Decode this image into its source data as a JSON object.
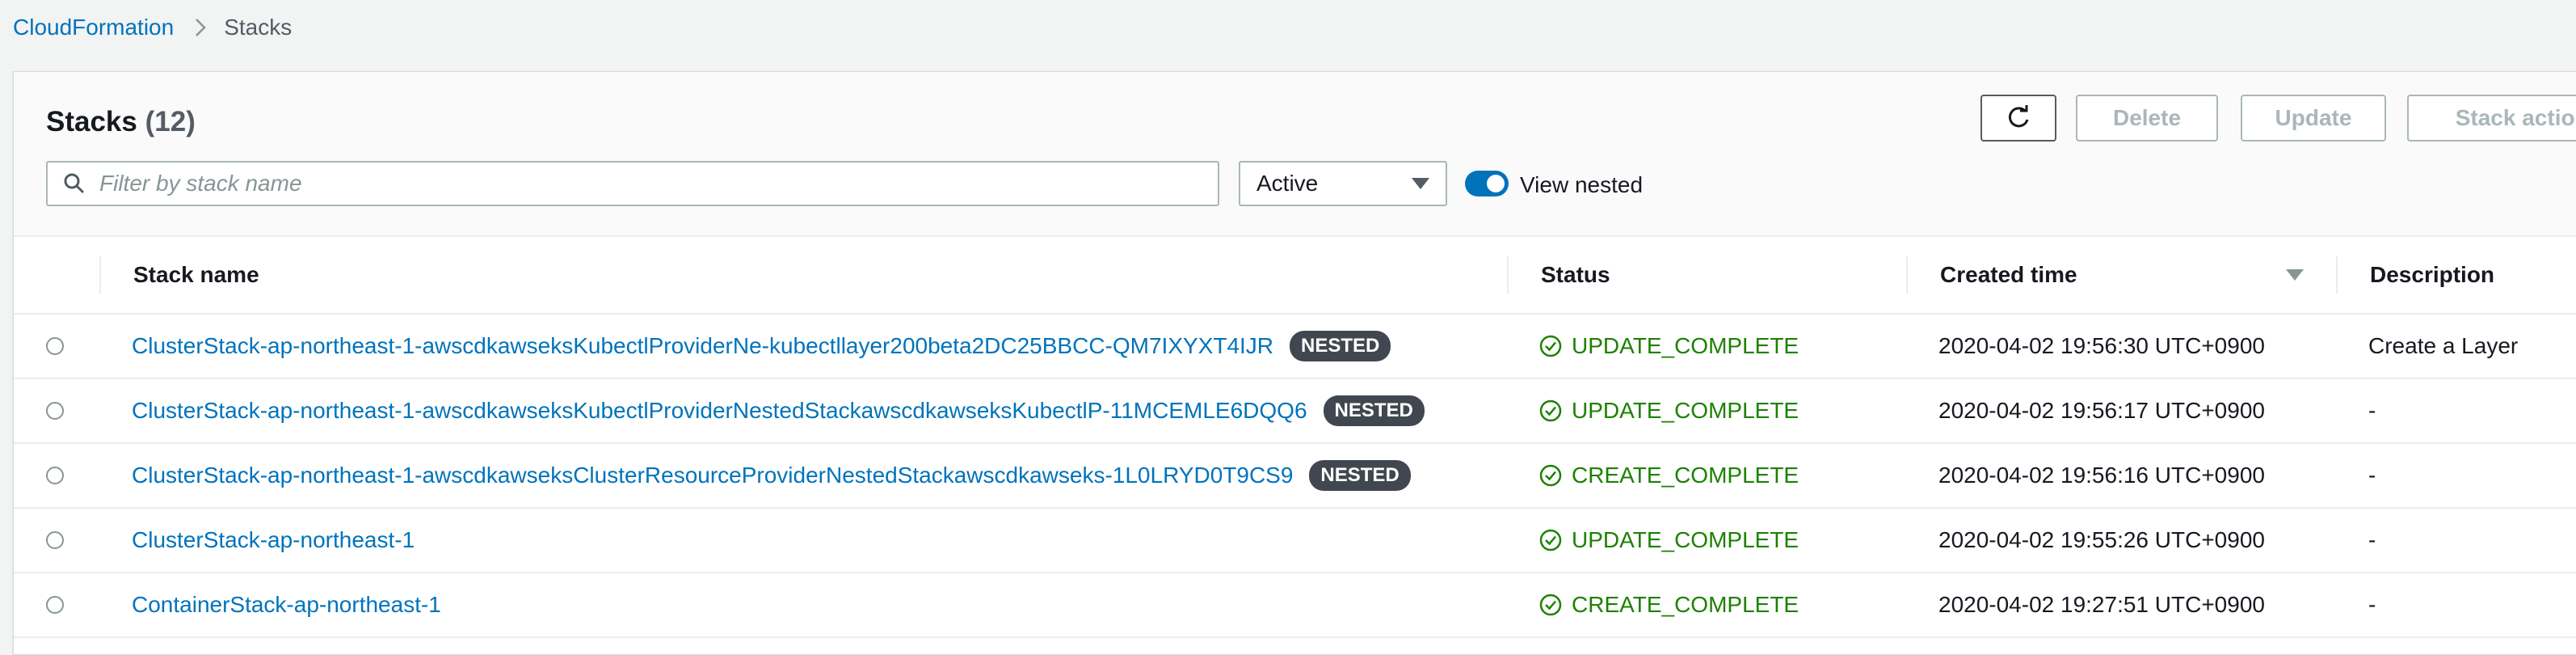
{
  "breadcrumb": {
    "root": "CloudFormation",
    "current": "Stacks"
  },
  "header": {
    "title": "Stacks",
    "count": "(12)",
    "buttons": {
      "delete": "Delete",
      "update": "Update",
      "actions": "Stack actions"
    }
  },
  "filter": {
    "placeholder": "Filter by stack name",
    "select_value": "Active",
    "toggle_label": "View nested",
    "toggle_on": true
  },
  "table": {
    "columns": [
      "Stack name",
      "Status",
      "Created time",
      "Description"
    ],
    "rows": [
      {
        "name": "ClusterStack-ap-northeast-1-awscdkawseksKubectlProviderNe-kubectllayer200beta2DC25BBCC-QM7IXYXT4IJR",
        "badge": "NESTED",
        "status": "UPDATE_COMPLETE",
        "created": "2020-04-02 19:56:30 UTC+0900",
        "description": "Create a Layer"
      },
      {
        "name": "ClusterStack-ap-northeast-1-awscdkawseksKubectlProviderNestedStackawscdkawseksKubectlP-11MCEMLE6DQQ6",
        "badge": "NESTED",
        "status": "UPDATE_COMPLETE",
        "created": "2020-04-02 19:56:17 UTC+0900",
        "description": "-"
      },
      {
        "name": "ClusterStack-ap-northeast-1-awscdkawseksClusterResourceProviderNestedStackawscdkawseks-1L0LRYD0T9CS9",
        "badge": "NESTED",
        "status": "CREATE_COMPLETE",
        "created": "2020-04-02 19:56:16 UTC+0900",
        "description": "-"
      },
      {
        "name": "ClusterStack-ap-northeast-1",
        "badge": "",
        "status": "UPDATE_COMPLETE",
        "created": "2020-04-02 19:55:26 UTC+0900",
        "description": "-"
      },
      {
        "name": "ContainerStack-ap-northeast-1",
        "badge": "",
        "status": "CREATE_COMPLETE",
        "created": "2020-04-02 19:27:51 UTC+0900",
        "description": "-"
      }
    ]
  },
  "colors": {
    "link": "#0073bb",
    "success": "#1d8102",
    "badge_bg": "#414750",
    "toggle": "#0073bb"
  },
  "icons": {
    "breadcrumb_separator": "chevron-right-icon",
    "refresh": "refresh-icon",
    "search": "search-icon",
    "select": "caret-down-icon",
    "status": "check-circle-icon",
    "sort": "sort-descending-icon"
  }
}
